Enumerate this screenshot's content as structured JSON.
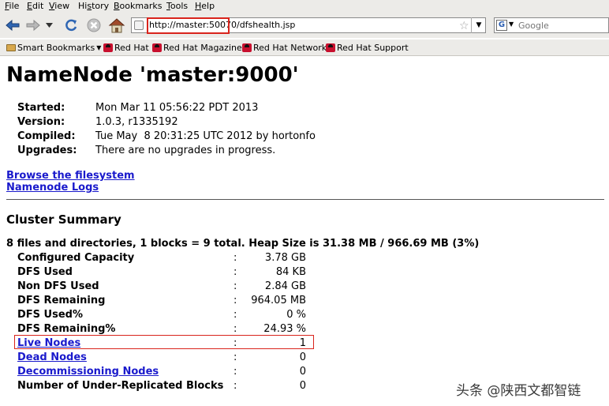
{
  "menu": {
    "items": [
      {
        "underline": "F",
        "rest": "ile"
      },
      {
        "underline": "E",
        "rest": "dit"
      },
      {
        "underline": "V",
        "rest": "iew"
      },
      {
        "before": "Hi",
        "underline": "s",
        "rest": "tory"
      },
      {
        "underline": "B",
        "rest": "ookmarks"
      },
      {
        "underline": "T",
        "rest": "ools"
      },
      {
        "underline": "H",
        "rest": "elp"
      }
    ]
  },
  "toolbar": {
    "back_icon": "back-arrow-icon",
    "forward_icon": "forward-arrow-icon",
    "reload_icon": "reload-icon",
    "stop_icon": "stop-icon",
    "home_icon": "home-icon",
    "url": "http://master:50070/dfshealth.jsp",
    "search_placeholder": "Google",
    "search_engine_letter": "G"
  },
  "bookmarks": {
    "smart": "Smart Bookmarks",
    "items": [
      "Red Hat",
      "Red Hat Magazine",
      "Red Hat Network",
      "Red Hat Support"
    ]
  },
  "page": {
    "title": "NameNode 'master:9000'",
    "info": [
      {
        "label": "Started:",
        "value": "Mon Mar 11 05:56:22 PDT 2013"
      },
      {
        "label": "Version:",
        "value": "1.0.3, r1335192"
      },
      {
        "label": "Compiled:",
        "value": "Tue May  8 20:31:25 UTC 2012 by hortonfo"
      },
      {
        "label": "Upgrades:",
        "value": "There are no upgrades in progress."
      }
    ],
    "links": [
      "Browse the filesystem",
      "Namenode Logs"
    ],
    "section_title": "Cluster Summary",
    "summary": "8 files and directories, 1 blocks = 9 total. Heap Size is 31.38 MB / 966.69 MB (3%)",
    "rows": [
      {
        "label": "Configured Capacity",
        "value": "3.78 GB"
      },
      {
        "label": "DFS Used",
        "value": "84 KB"
      },
      {
        "label": "Non DFS Used",
        "value": "2.84 GB"
      },
      {
        "label": "DFS Remaining",
        "value": "964.05 MB"
      },
      {
        "label": "DFS Used%",
        "value": "0 %"
      },
      {
        "label": "DFS Remaining%",
        "value": "24.93 %"
      },
      {
        "label": "Live Nodes",
        "value": "1"
      },
      {
        "label": "Dead Nodes",
        "value": "0"
      },
      {
        "label": "Decommissioning Nodes",
        "value": "0"
      },
      {
        "label": "Number of Under-Replicated Blocks",
        "value": "0"
      }
    ],
    "colon": ":"
  },
  "watermark": "头条 @陕西文都智链",
  "colors": {
    "chrome": "#ecebe8",
    "link": "#1a1acc",
    "highlight": "#d9241c"
  }
}
